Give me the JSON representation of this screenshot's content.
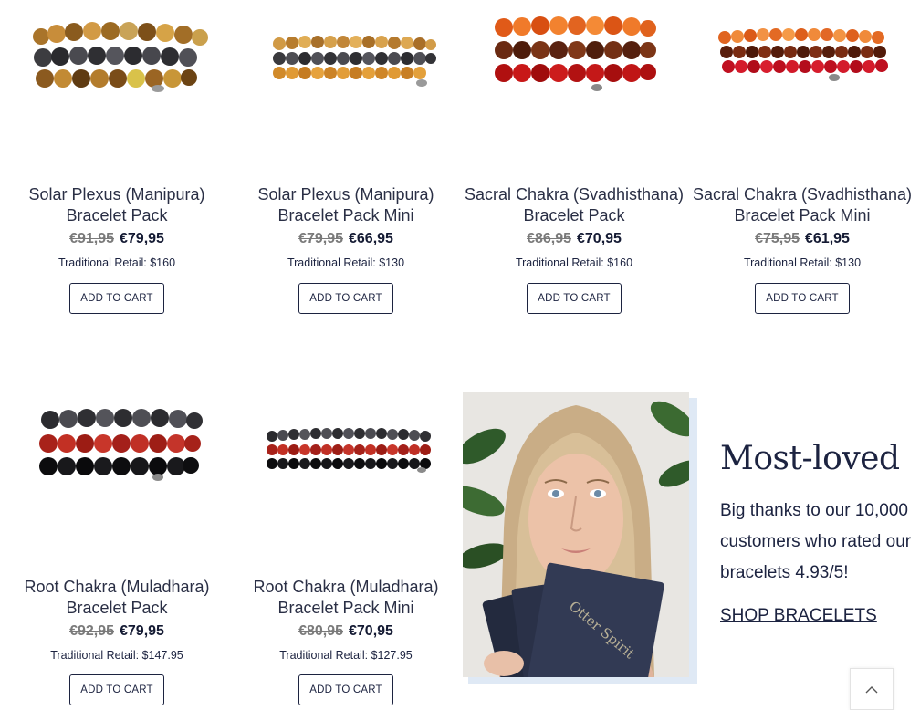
{
  "colors": {
    "text": "#1c2340",
    "old_price": "#7a7a7a",
    "photo_frame": "#dfe9f5"
  },
  "products": [
    {
      "name_line1": "Solar Plexus (Manipura)",
      "name_line2": "Bracelet Pack",
      "old_price": "€91,95",
      "price": "€79,95",
      "retail": "Traditional Retail: $160",
      "cart_label": "ADD TO CART",
      "image": "amber-tigers-eye-hematite-bracelets"
    },
    {
      "name_line1": "Solar Plexus (Manipura)",
      "name_line2": "Bracelet Pack Mini",
      "old_price": "€79,95",
      "price": "€66,95",
      "retail": "Traditional Retail: $130",
      "cart_label": "ADD TO CART",
      "image": "amber-hematite-mini-bracelets"
    },
    {
      "name_line1": "Sacral Chakra (Svadhisthana)",
      "name_line2": "Bracelet Pack",
      "old_price": "€86,95",
      "price": "€70,95",
      "retail": "Traditional Retail: $160",
      "cart_label": "ADD TO CART",
      "image": "carnelian-red-bracelets"
    },
    {
      "name_line1": "Sacral Chakra (Svadhisthana)",
      "name_line2": "Bracelet Pack Mini",
      "old_price": "€75,95",
      "price": "€61,95",
      "retail": "Traditional Retail: $130",
      "cart_label": "ADD TO CART",
      "image": "carnelian-red-mini-bracelets"
    },
    {
      "name_line1": "Root Chakra (Muladhara)",
      "name_line2": "Bracelet Pack",
      "old_price": "€92,95",
      "price": "€79,95",
      "retail": "Traditional Retail: $147.95",
      "cart_label": "ADD TO CART",
      "image": "hematite-red-jasper-onyx-bracelets"
    },
    {
      "name_line1": "Root Chakra (Muladhara)",
      "name_line2": "Bracelet Pack Mini",
      "old_price": "€80,95",
      "price": "€70,95",
      "retail": "Traditional Retail: $127.95",
      "cart_label": "ADD TO CART",
      "image": "hematite-red-jasper-onyx-mini-bracelets"
    }
  ],
  "promo": {
    "title": "Most-loved",
    "text": "Big thanks to our 10,000 customers who rated our bracelets 4.93/5!",
    "link": "SHOP BRACELETS",
    "card_text": "Otter Spirit",
    "photo": "woman-holding-otter-spirit-cards"
  },
  "back_to_top_icon": "chevron-up-icon"
}
